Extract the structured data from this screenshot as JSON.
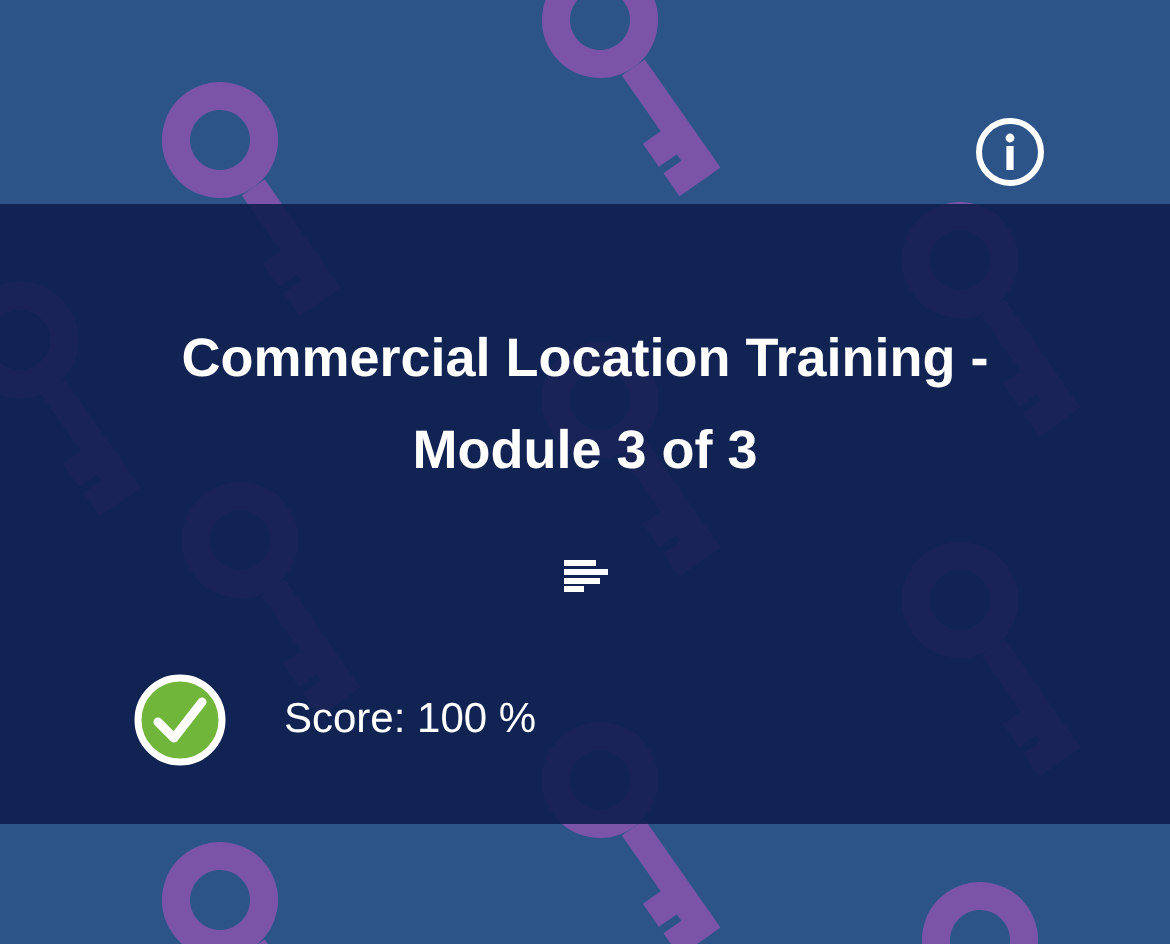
{
  "card": {
    "title": "Commercial Location Training - Module 3 of 3",
    "completed": true,
    "score": "Score: 100 %"
  }
}
